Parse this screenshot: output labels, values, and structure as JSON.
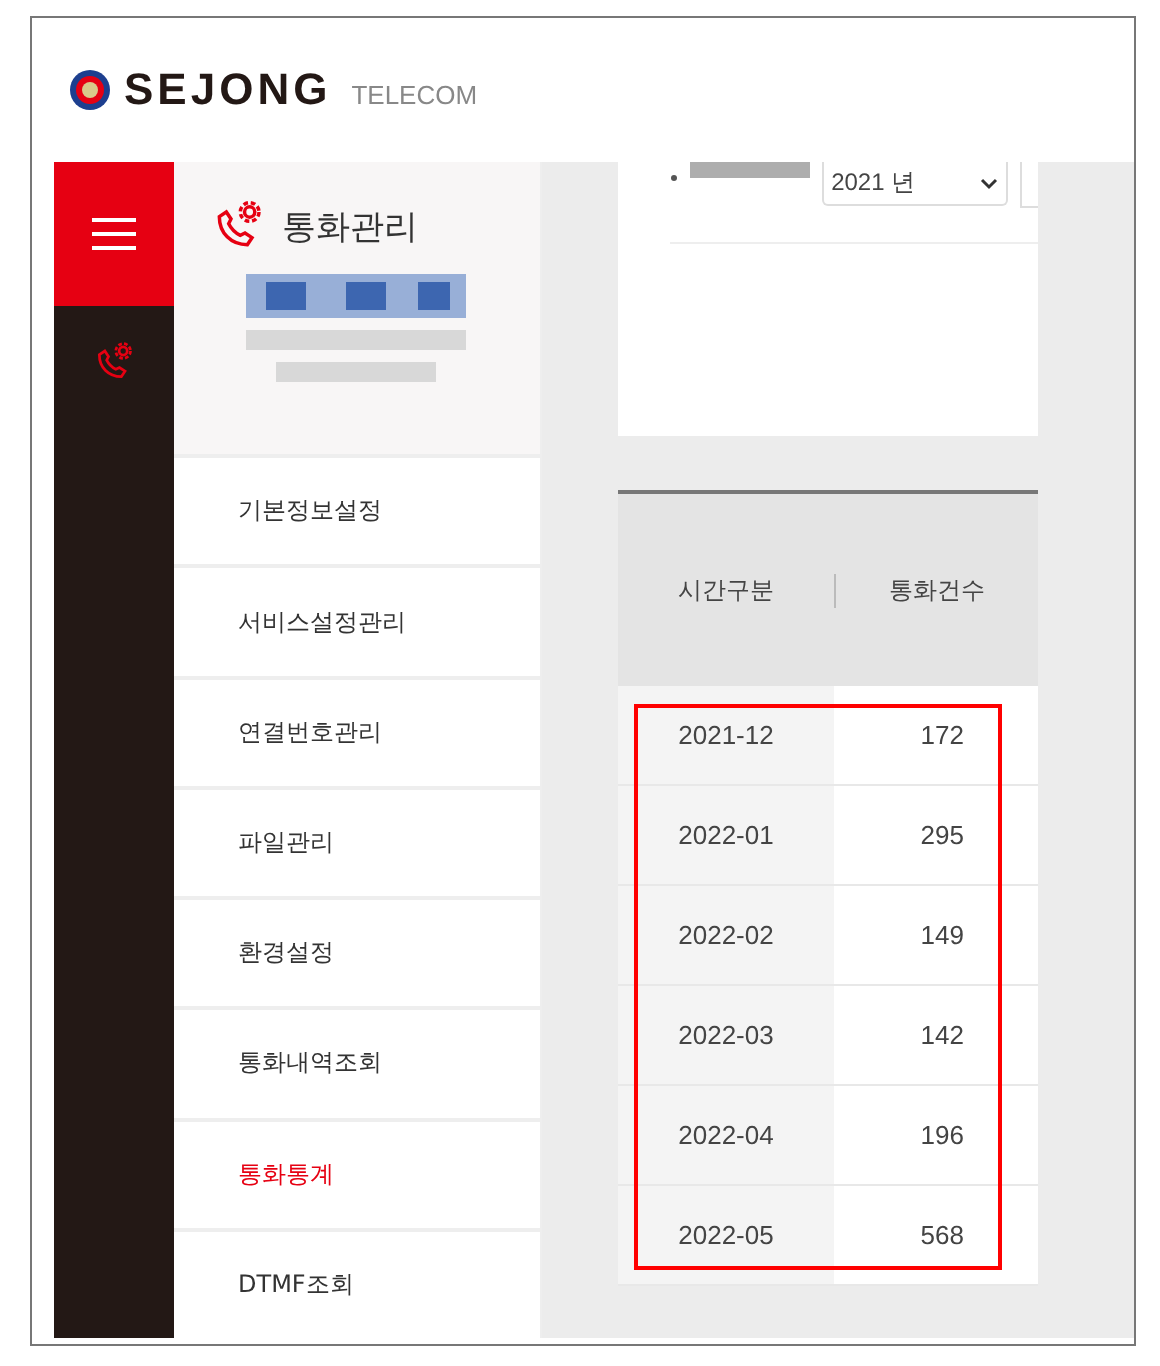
{
  "logo": {
    "brand": "SEJONG",
    "sub": "TELECOM"
  },
  "sidebar": {
    "title": "통화관리",
    "items": [
      {
        "label": "기본정보설정",
        "selected": false
      },
      {
        "label": "서비스설정관리",
        "selected": false
      },
      {
        "label": "연결번호관리",
        "selected": false
      },
      {
        "label": "파일관리",
        "selected": false
      },
      {
        "label": "환경설정",
        "selected": false
      },
      {
        "label": "통화내역조회",
        "selected": false
      },
      {
        "label": "통화통계",
        "selected": true
      },
      {
        "label": "DTMF조회",
        "selected": false
      }
    ]
  },
  "filter": {
    "year": "2021 년"
  },
  "table": {
    "columns": [
      "시간구분",
      "통화건수"
    ],
    "rows": [
      [
        "2021-12",
        "172"
      ],
      [
        "2022-01",
        "295"
      ],
      [
        "2022-02",
        "149"
      ],
      [
        "2022-03",
        "142"
      ],
      [
        "2022-04",
        "196"
      ],
      [
        "2022-05",
        "568"
      ]
    ]
  }
}
